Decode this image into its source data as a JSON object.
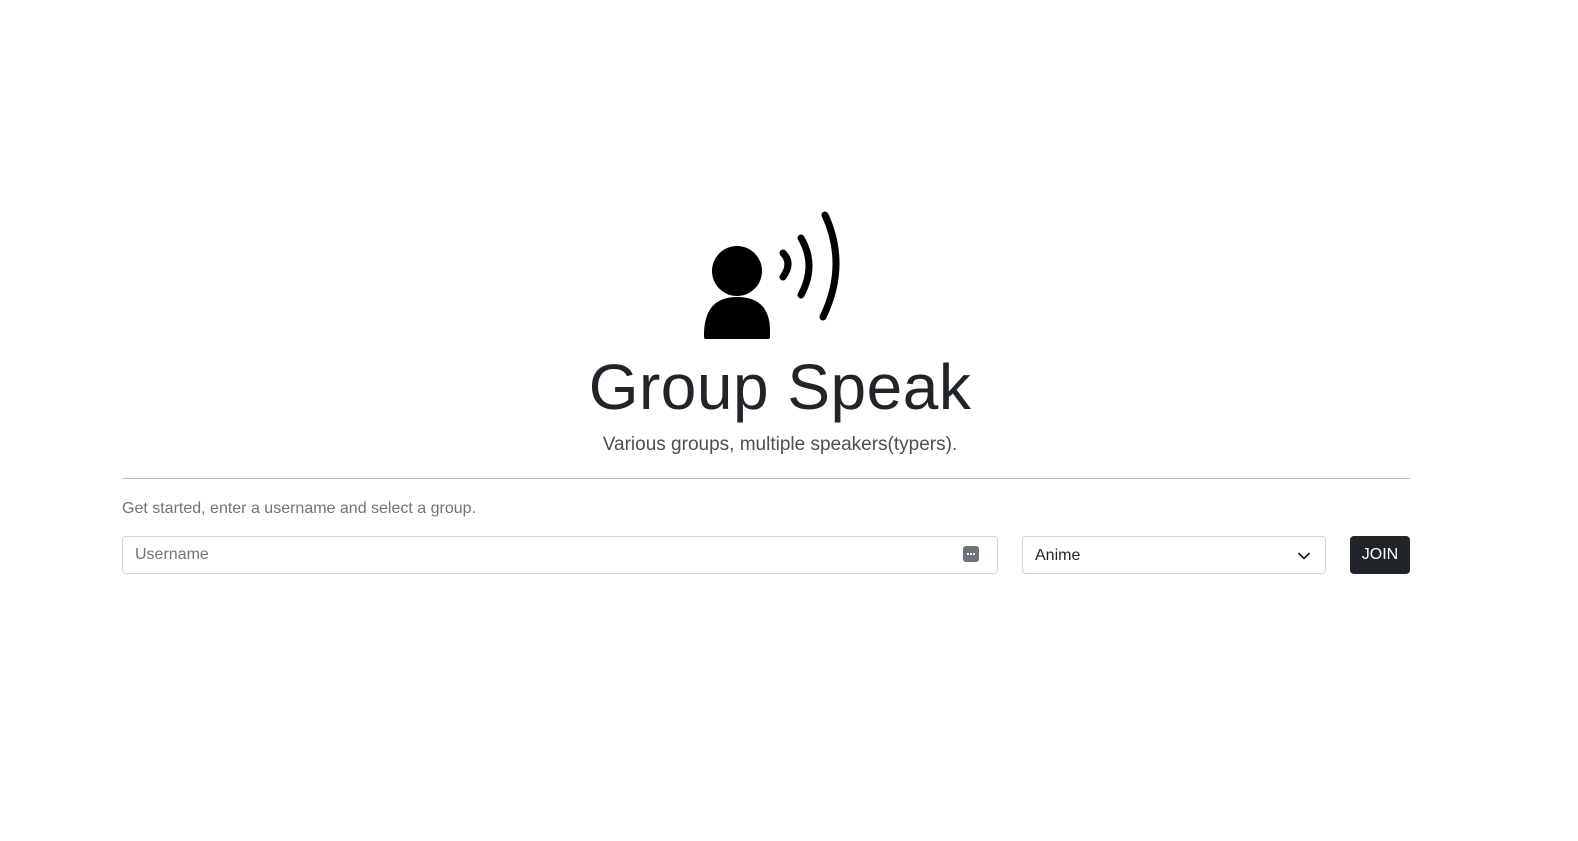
{
  "hero": {
    "logo_icon": "person-speaking-icon",
    "title": "Group Speak",
    "subtitle": "Various groups, multiple speakers(typers)."
  },
  "form": {
    "helper_text": "Get started, enter a username and select a group.",
    "username": {
      "placeholder": "Username",
      "value": "",
      "icon": "password-manager-icon"
    },
    "group_select": {
      "selected": "Anime",
      "icon": "chevron-down-icon"
    },
    "join_label": "JOIN"
  },
  "colors": {
    "text": "#212529",
    "muted": "#6c757d",
    "border": "#ced4da",
    "button_bg": "#212529",
    "button_text": "#ffffff"
  }
}
